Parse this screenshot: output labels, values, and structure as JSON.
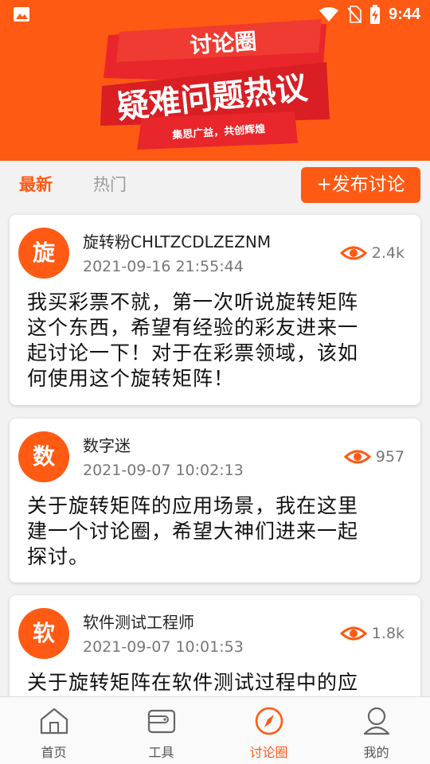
{
  "status_bar": {
    "time": "9:44"
  },
  "banner": {
    "top_text": "讨论圈",
    "main_text": "疑难问题热议",
    "slogan": "集思广益，共创辉煌"
  },
  "tabs": {
    "latest": "最新",
    "hot": "热门"
  },
  "publish_button": "+发布讨论",
  "posts": [
    {
      "avatar_char": "旋",
      "author": "旋转粉CHLTZCDLZEZNM",
      "date": "2021-09-16 21:55:44",
      "views": "2.4k",
      "lines": [
        "我买彩票不就，第一次听说旋转矩阵",
        "这个东西，希望有经验的彩友进来一",
        "起讨论一下！对于在彩票领域，该如",
        "何使用这个旋转矩阵！"
      ]
    },
    {
      "avatar_char": "数",
      "author": "数字迷",
      "date": "2021-09-07 10:02:13",
      "views": "957",
      "lines": [
        "关于旋转矩阵的应用场景，我在这里",
        "建一个讨论圈，希望大神们进来一起",
        "探讨。"
      ]
    },
    {
      "avatar_char": "软",
      "author": "软件测试工程师",
      "date": "2021-09-07 10:01:53",
      "views": "1.8k",
      "lines": [
        "关于旋转矩阵在软件测试过程中的应"
      ]
    }
  ],
  "bottom_nav": [
    {
      "label": "首页",
      "icon": "home-icon"
    },
    {
      "label": "工具",
      "icon": "wallet-icon"
    },
    {
      "label": "讨论圈",
      "icon": "compass-icon"
    },
    {
      "label": "我的",
      "icon": "user-icon"
    }
  ],
  "colors": {
    "accent": "#ff5a14",
    "banner_red": "#e8262b"
  }
}
